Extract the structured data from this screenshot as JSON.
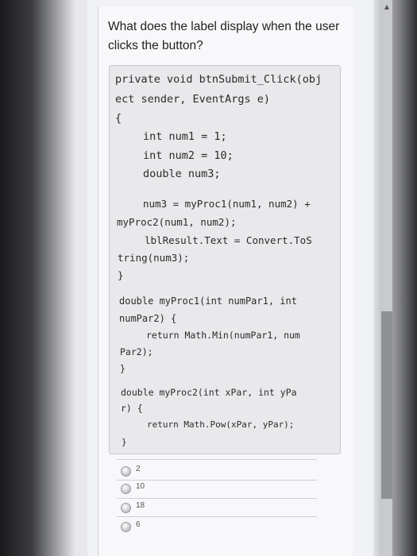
{
  "question": {
    "line1": "What does the label display when the user",
    "line2": "clicks the button?"
  },
  "code_lines": [
    "private void btnSubmit_Click(obj",
    "ect sender, EventArgs e)",
    "{",
    "int num1 = 1;",
    "int num2 = 10;",
    "double num3;",
    "num3 = myProc1(num1, num2) +",
    "myProc2(num1, num2);",
    "lblResult.Text = Convert.ToS",
    "tring(num3);",
    "}",
    "double myProc1(int numPar1, int",
    "numPar2) {",
    "return Math.Min(numPar1, num",
    "Par2);",
    "}",
    "double myProc2(int xPar, int yPa",
    "r) {",
    "return Math.Pow(xPar, yPar);",
    "}"
  ],
  "choices": [
    "2",
    "10",
    "18",
    "6"
  ],
  "icons": {
    "radio": "radio-button-icon",
    "scroll_up": "scroll-up-arrow-icon"
  },
  "colors": {
    "code_background": "#e9e9ec",
    "page_background": "#f1f2f5"
  }
}
